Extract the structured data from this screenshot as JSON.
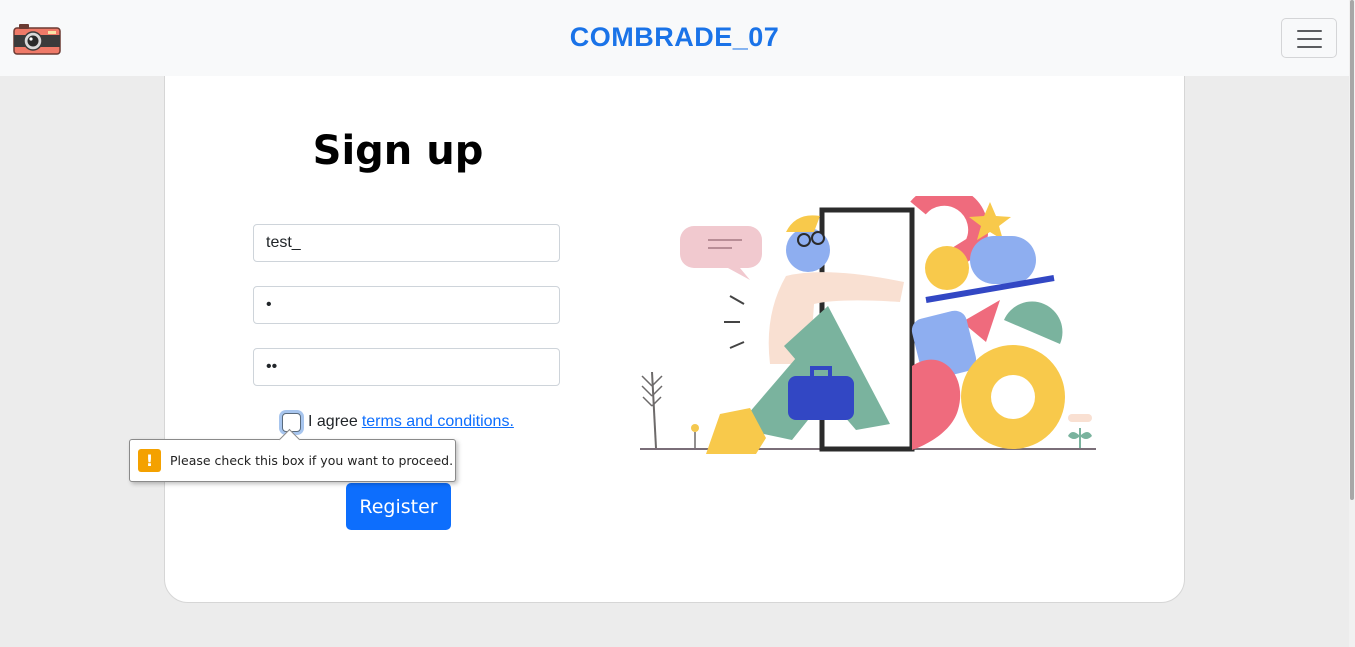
{
  "navbar": {
    "brand": "COMBRADE_07",
    "logo_icon": "camera-icon",
    "toggler_icon": "hamburger-menu-icon"
  },
  "form": {
    "title": "Sign up",
    "username_value": "test_",
    "password_value": "•",
    "confirm_value": "••",
    "agree_text": "I agree",
    "terms_link": "terms and conditions.",
    "checkbox_checked": false,
    "register_label": "Register"
  },
  "validation": {
    "icon": "warning-icon",
    "message": "Please check this box if you want to proceed."
  },
  "colors": {
    "brand": "#1a73e8",
    "primary_button": "#0d6efd",
    "warning": "#f4a100",
    "background": "#ececec"
  }
}
